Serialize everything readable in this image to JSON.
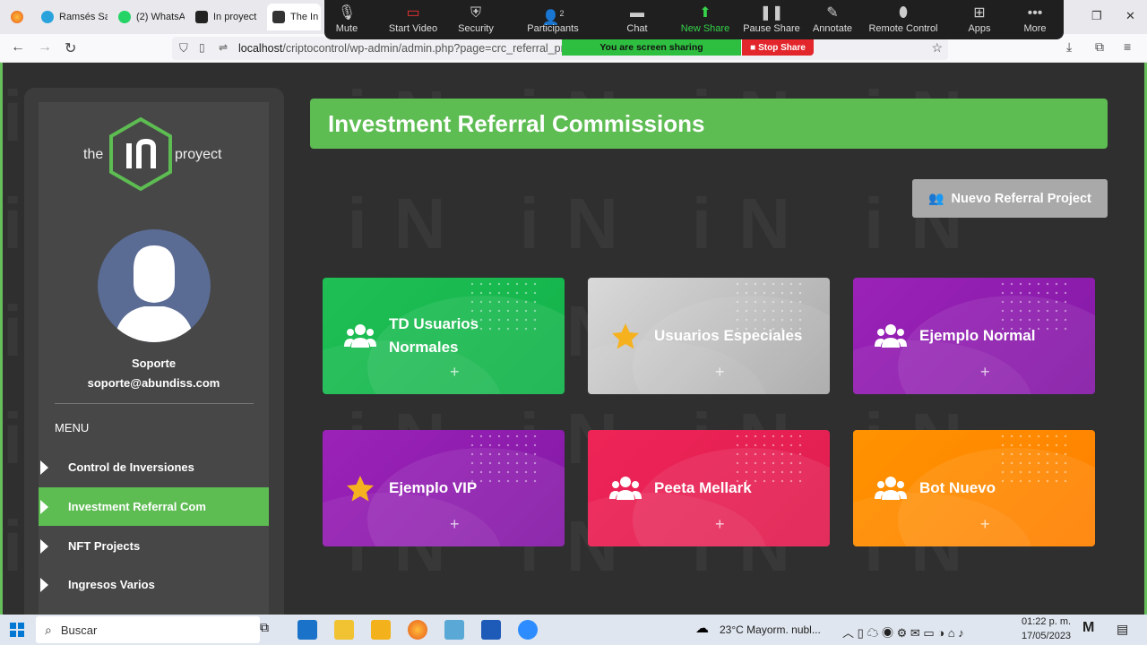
{
  "browser": {
    "tabs": [
      {
        "label": "Ramsés Sa"
      },
      {
        "label": "(2) WhatsA"
      },
      {
        "label": "In proyect"
      },
      {
        "label": "The In"
      }
    ],
    "url_prefix": "localhost",
    "url_rest": "/criptocontrol/wp-admin/admin.php?page=crc_referral_princi"
  },
  "zoom": {
    "buttons": [
      {
        "label": "Mute",
        "icon": "mic-icon"
      },
      {
        "label": "Start Video",
        "icon": "video-off-icon"
      },
      {
        "label": "Security",
        "icon": "shield-icon"
      },
      {
        "label": "Participants",
        "icon": "participants-icon",
        "count": "2"
      },
      {
        "label": "Chat",
        "icon": "chat-icon"
      },
      {
        "label": "New Share",
        "icon": "share-icon"
      },
      {
        "label": "Pause Share",
        "icon": "pause-icon"
      },
      {
        "label": "Annotate",
        "icon": "pen-icon"
      },
      {
        "label": "Remote Control",
        "icon": "mouse-icon"
      },
      {
        "label": "Apps",
        "icon": "apps-icon"
      },
      {
        "label": "More",
        "icon": "more-icon"
      }
    ],
    "sharing_text": "You are screen sharing",
    "stop_share": "Stop Share"
  },
  "sidebar": {
    "logo_left": "the",
    "logo_right": "proyect",
    "user_name": "Soporte",
    "user_email": "soporte@abundiss.com",
    "menu_title": "MENU",
    "items": [
      {
        "label": "Control de Inversiones",
        "active": false
      },
      {
        "label": "Investment Referral Com",
        "active": true
      },
      {
        "label": "NFT Projects",
        "active": false
      },
      {
        "label": "Ingresos Varios",
        "active": false
      }
    ]
  },
  "main": {
    "title": "Investment Referral Commissions",
    "new_button": "Nuevo Referral Project",
    "cards": [
      {
        "label": "TD Usuarios Normales",
        "icon": "users-icon",
        "color": "#1fbf55"
      },
      {
        "label": "Usuarios Especiales",
        "icon": "star-icon",
        "color": "#b9b9b9"
      },
      {
        "label": "Ejemplo Normal",
        "icon": "users-icon",
        "color": "#8e1fb0"
      },
      {
        "label": "Ejemplo VIP",
        "icon": "star-icon",
        "color": "#8e1fb0"
      },
      {
        "label": "Peeta Mellark",
        "icon": "users-icon",
        "color": "#e8205a"
      },
      {
        "label": "Bot Nuevo",
        "icon": "users-icon",
        "color": "#ff8a00"
      }
    ],
    "plus": "+"
  },
  "taskbar": {
    "search": "Buscar",
    "weather": "23°C  Mayorm. nubl...",
    "time": "01:22 p. m.",
    "date": "17/05/2023"
  },
  "colors": {
    "accent": "#5dbc52"
  }
}
